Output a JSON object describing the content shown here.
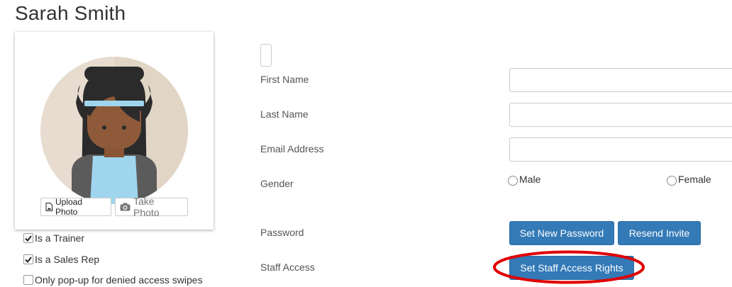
{
  "page_title": "Sarah Smith",
  "photo": {
    "upload_label": "Upload Photo",
    "take_label": "Take Photo",
    "upload_icon": "file-image-icon",
    "take_icon": "camera-icon"
  },
  "checkboxes": [
    {
      "label": "Is a Trainer",
      "checked": true
    },
    {
      "label": "Is a Sales Rep",
      "checked": true
    },
    {
      "label": "Only pop-up for denied access swipes",
      "checked": false
    }
  ],
  "form": {
    "first_name_label": "First Name",
    "last_name_label": "Last Name",
    "email_label": "Email Address",
    "gender_label": "Gender",
    "gender_options": [
      "Male",
      "Female"
    ],
    "password_label": "Password",
    "set_password_button": "Set New Password",
    "resend_invite_button": "Resend Invite",
    "staff_access_label": "Staff Access",
    "staff_access_button": "Set Staff Access Rights"
  },
  "colors": {
    "primary": "#337ab7",
    "highlight": "#e00000"
  }
}
